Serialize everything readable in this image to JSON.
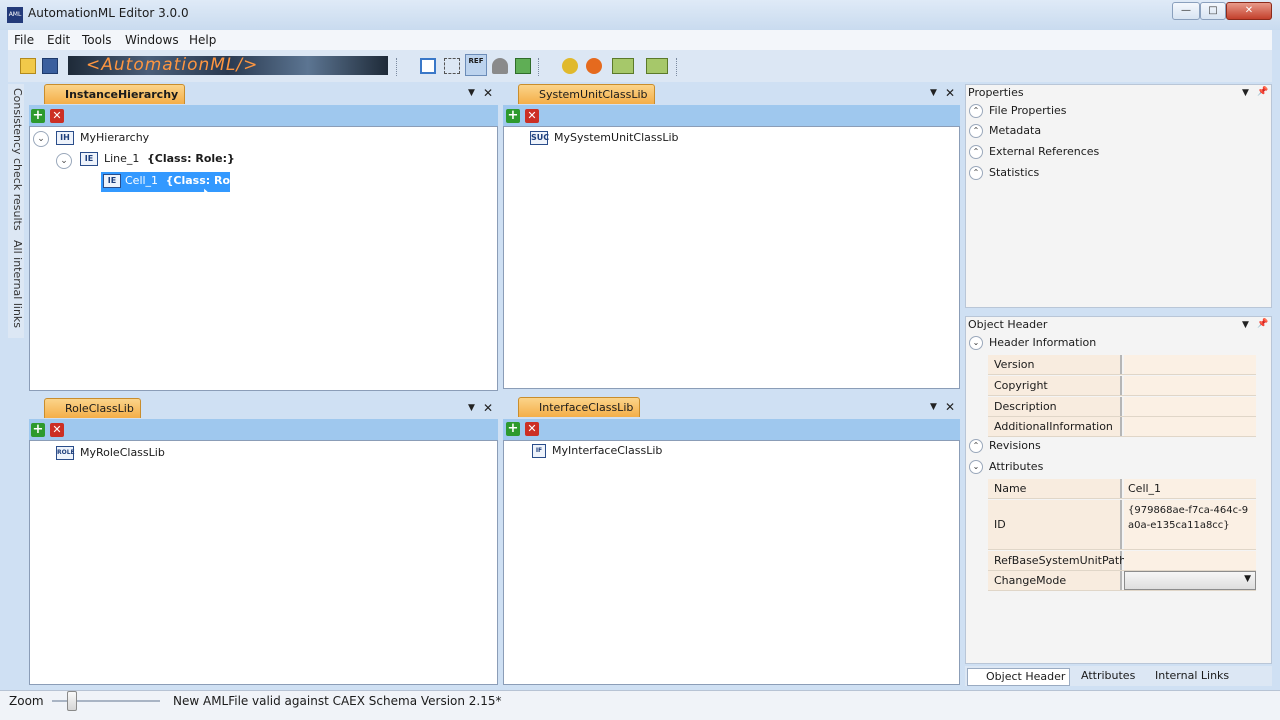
{
  "window": {
    "title": "AutomationML Editor 3.0.0",
    "icon_text": "AML",
    "min": "—",
    "max": "□",
    "close": "✕"
  },
  "menu": [
    "File",
    "Edit",
    "Tools",
    "Windows",
    "Help"
  ],
  "toolbar": {
    "banner": "<AutomationML/>",
    "ref_label": "REF"
  },
  "left_strip": {
    "tab1": "Consistency check results",
    "tab2": "All internal links"
  },
  "panels": {
    "instance_hierarchy": {
      "tab": "InstanceHierarchy",
      "tree": [
        {
          "label": "MyHierarchy",
          "icon": "IH"
        },
        {
          "label": "Line_1",
          "suffix": "{Class: Role:}",
          "icon": "IE"
        },
        {
          "label": "Cell_1",
          "suffix": "{Class: Role:}",
          "icon": "IE",
          "selected": true
        }
      ]
    },
    "system_unit_class_lib": {
      "tab": "SystemUnitClassLib",
      "tree": [
        {
          "label": "MySystemUnitClassLib",
          "icon": "SUC"
        }
      ]
    },
    "role_class_lib": {
      "tab": "RoleClassLib",
      "tree": [
        {
          "label": "MyRoleClassLib",
          "icon": "ROLE"
        }
      ]
    },
    "interface_class_lib": {
      "tab": "InterfaceClassLib",
      "tree": [
        {
          "label": "MyInterfaceClassLib",
          "icon": "IF"
        }
      ]
    }
  },
  "properties": {
    "title": "Properties",
    "sections": [
      "File Properties",
      "Metadata",
      "External References",
      "Statistics"
    ]
  },
  "object_header": {
    "title": "Object Header",
    "header_information": "Header Information",
    "header_rows": [
      {
        "label": "Version",
        "value": ""
      },
      {
        "label": "Copyright",
        "value": ""
      },
      {
        "label": "Description",
        "value": ""
      },
      {
        "label": "AdditionalInformation",
        "value": ""
      }
    ],
    "revisions": "Revisions",
    "attributes": "Attributes",
    "attr_rows": [
      {
        "label": "Name",
        "value": "Cell_1"
      },
      {
        "label": "ID",
        "value": "{979868ae-f7ca-464c-9a0a-e135ca11a8cc}"
      },
      {
        "label": "RefBaseSystemUnitPath",
        "value": ""
      },
      {
        "label": "ChangeMode",
        "value": ""
      }
    ]
  },
  "bottom_tabs": [
    "Object Header",
    "Attributes",
    "Internal Links"
  ],
  "status": {
    "zoom_label": "Zoom",
    "file": "New AMLFile",
    "validation": "valid against CAEX Schema Version 2.15*"
  }
}
